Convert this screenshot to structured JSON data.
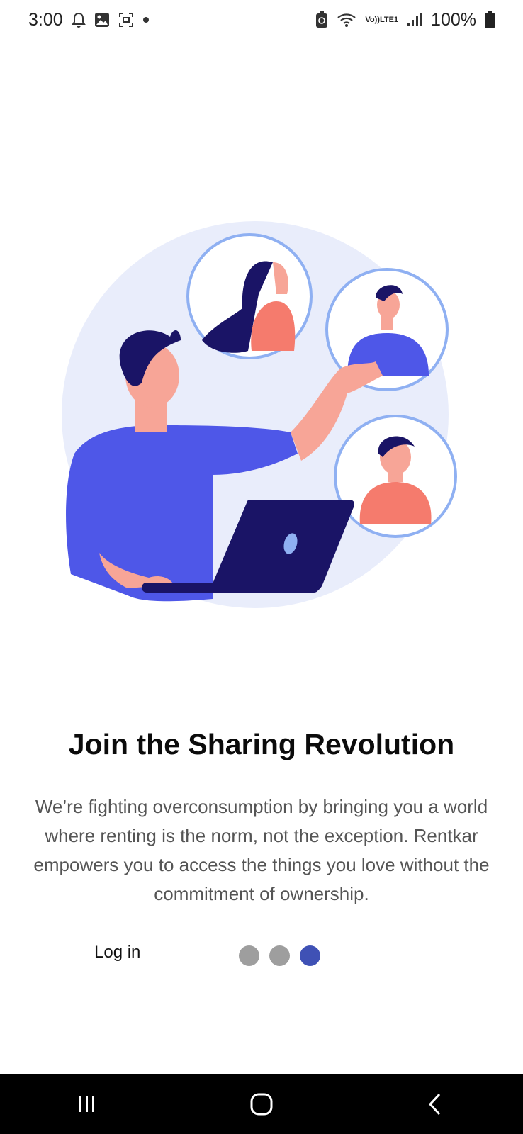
{
  "status_bar": {
    "time": "3:00",
    "battery_percent": "100%",
    "network_top": "Vo))",
    "network_bottom": "LTE1",
    "icons": [
      "bell-icon",
      "image-icon",
      "screenshot-icon",
      "dot-icon",
      "recycle-icon",
      "wifi-icon",
      "signal-icon",
      "battery-icon"
    ]
  },
  "onboarding": {
    "title": "Join the Sharing Revolution",
    "description": "We’re fighting overconsumption by bringing you a world where renting is the norm, not the exception. Rentkar empowers you to access the things you love without the commitment of ownership.",
    "login_label": "Log in",
    "pager": {
      "total": 3,
      "active_index": 2
    }
  },
  "colors": {
    "accent": "#3f51b5",
    "dot_inactive": "#9e9e9e",
    "illustration_shirt": "#4e57e8",
    "illustration_skin": "#f7a597",
    "illustration_hair": "#1a1466",
    "illustration_circle_bg": "#e9edfb"
  },
  "nav_bar": {
    "icons": [
      "recent-apps-icon",
      "home-icon",
      "back-icon"
    ]
  }
}
